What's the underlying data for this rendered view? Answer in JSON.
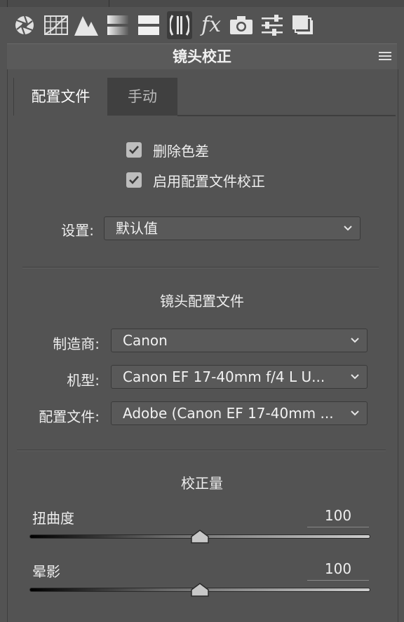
{
  "toolbar": {
    "icons": [
      "aperture-icon",
      "grid-icon",
      "tone-curve-icon",
      "gradient-icon",
      "split-tone-icon",
      "lens-icon",
      "fx-icon",
      "camera-icon",
      "sliders-icon",
      "presets-icon"
    ],
    "fx_label": "fx"
  },
  "panel": {
    "title": "镜头校正"
  },
  "tabs": [
    {
      "label": "配置文件",
      "active": true
    },
    {
      "label": "手动",
      "active": false
    }
  ],
  "checks": [
    {
      "label": "删除色差",
      "checked": true
    },
    {
      "label": "启用配置文件校正",
      "checked": true
    }
  ],
  "setup": {
    "label": "设置:",
    "value": "默认值"
  },
  "lens_profile": {
    "title": "镜头配置文件",
    "fields": [
      {
        "label": "制造商:",
        "value": "Canon"
      },
      {
        "label": "机型:",
        "value": "Canon EF 17-40mm f/4 L U..."
      },
      {
        "label": "配置文件:",
        "value": "Adobe (Canon EF 17-40mm ..."
      }
    ]
  },
  "correction": {
    "title": "校正量",
    "sliders": [
      {
        "label": "扭曲度",
        "value": "100",
        "fraction": 0.5
      },
      {
        "label": "晕影",
        "value": "100",
        "fraction": 0.5
      }
    ]
  },
  "colors": {
    "background": "#535353",
    "header": "#5a5a5a",
    "inactive_tab": "#404040"
  }
}
